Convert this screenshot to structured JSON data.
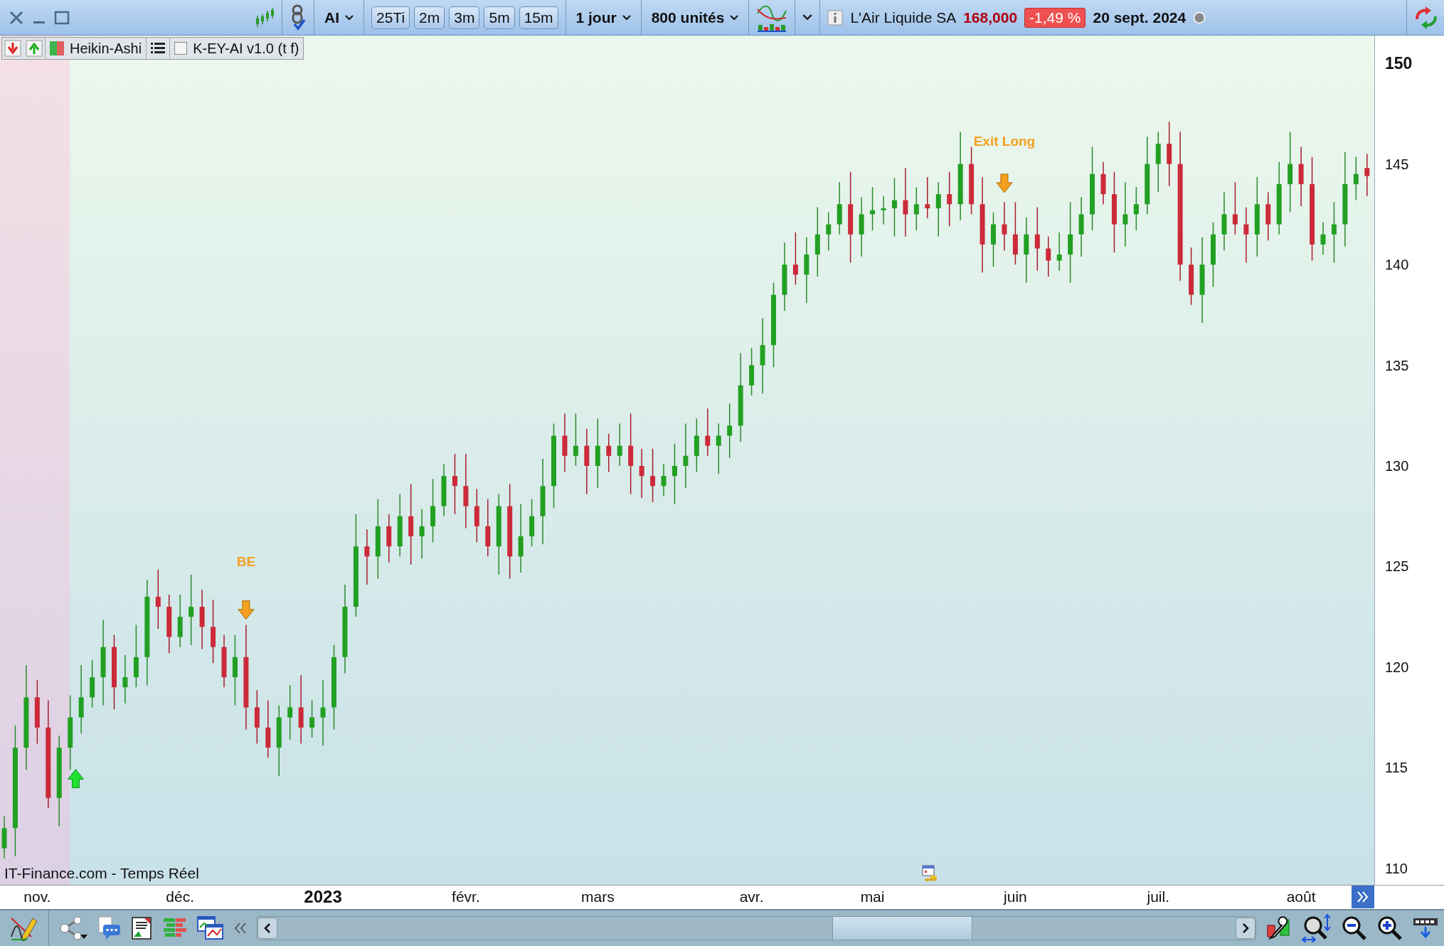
{
  "toolbar": {
    "instrument_code": "AI",
    "intervals": [
      {
        "label": "25Ti",
        "selected": false
      },
      {
        "label": "2m",
        "selected": false
      },
      {
        "label": "3m",
        "selected": false
      },
      {
        "label": "5m",
        "selected": false
      },
      {
        "label": "15m",
        "selected": false
      }
    ],
    "period": "1 jour",
    "units": "800 unités",
    "instrument": {
      "name": "L'Air Liquide SA",
      "price": "168,000",
      "change": "-1,49 %",
      "date": "20 sept. 2024"
    }
  },
  "chart_legend": {
    "style": "Heikin-Ashi",
    "indicator": {
      "label": "K-EY-AI v1.0 (t f)",
      "checked": false
    }
  },
  "chart": {
    "source": "IT-Finance.com - Temps Réel",
    "signals": [
      {
        "kind": "buy"
      },
      {
        "kind": "sell"
      },
      {
        "kind": "sell"
      }
    ],
    "chart_data": {
      "type": "candlestick",
      "ylim": [
        109.15,
        151.38
      ],
      "yticks": [
        110,
        115,
        120,
        125,
        130,
        135,
        140,
        145,
        150
      ],
      "categories": [
        null,
        null,
        null,
        "nov.",
        null,
        null,
        null,
        null,
        null,
        null,
        null,
        null,
        null,
        null,
        null,
        null,
        "déc.",
        null,
        null,
        null,
        null,
        null,
        null,
        null,
        null,
        null,
        null,
        null,
        null,
        "2023",
        null,
        null,
        null,
        null,
        null,
        null,
        null,
        null,
        null,
        null,
        null,
        null,
        "févr.",
        null,
        null,
        null,
        null,
        null,
        null,
        null,
        null,
        null,
        null,
        null,
        "mars",
        null,
        null,
        null,
        null,
        null,
        null,
        null,
        null,
        null,
        null,
        null,
        null,
        null,
        "avr.",
        null,
        null,
        null,
        null,
        null,
        null,
        null,
        null,
        null,
        null,
        "mai",
        null,
        null,
        null,
        null,
        null,
        null,
        null,
        null,
        null,
        null,
        null,
        null,
        "juin",
        null,
        null,
        null,
        null,
        null,
        null,
        null,
        null,
        null,
        null,
        null,
        null,
        "juil.",
        null,
        null,
        null,
        null,
        null,
        null,
        null,
        null,
        null,
        null,
        null,
        null,
        "août",
        null,
        null,
        null,
        null,
        null,
        null
      ],
      "ohlc": [
        [
          111,
          112.6,
          110.5,
          112
        ],
        [
          112,
          117.1,
          110.6,
          116
        ],
        [
          116,
          120.1,
          114.9,
          118.5
        ],
        [
          118.5,
          119.35,
          116.2,
          117
        ],
        [
          117,
          118.35,
          113,
          113.5
        ],
        [
          113.5,
          116.6,
          112.1,
          116
        ],
        [
          116,
          118.6,
          114.9,
          117.5
        ],
        [
          117.5,
          120.1,
          116.7,
          118.5
        ],
        [
          118.5,
          120.35,
          118,
          119.5
        ],
        [
          119.5,
          122.35,
          118.1,
          121
        ],
        [
          121,
          121.6,
          117.9,
          119
        ],
        [
          119,
          120.6,
          118.2,
          119.5
        ],
        [
          119.5,
          122.1,
          119,
          120.5
        ],
        [
          120.5,
          124.35,
          119.1,
          123.5
        ],
        [
          123.5,
          124.85,
          121.9,
          123
        ],
        [
          123,
          123.6,
          120.7,
          121.5
        ],
        [
          121.5,
          123.6,
          121,
          122.5
        ],
        [
          122.5,
          124.6,
          121.1,
          123
        ],
        [
          123,
          123.85,
          120.9,
          122
        ],
        [
          122,
          123.35,
          120.2,
          121
        ],
        [
          121,
          121.6,
          119,
          119.5
        ],
        [
          119.5,
          121.6,
          118.1,
          120.5
        ],
        [
          120.5,
          122.1,
          116.9,
          118
        ],
        [
          118,
          118.85,
          116.2,
          117
        ],
        [
          117,
          118.35,
          115.5,
          116
        ],
        [
          116,
          118.1,
          114.6,
          117.5
        ],
        [
          117.5,
          119.1,
          116.4,
          118
        ],
        [
          118,
          119.6,
          116.2,
          117
        ],
        [
          117,
          118.35,
          116.5,
          117.5
        ],
        [
          117.5,
          119.35,
          116.1,
          118
        ],
        [
          118,
          121.1,
          116.9,
          120.5
        ],
        [
          120.5,
          124.1,
          119.7,
          123
        ],
        [
          123,
          127.6,
          122.5,
          126
        ],
        [
          126,
          126.85,
          124.1,
          125.5
        ],
        [
          125.5,
          128.35,
          124.4,
          127
        ],
        [
          127,
          127.6,
          125.2,
          126
        ],
        [
          126,
          128.6,
          125.5,
          127.5
        ],
        [
          127.5,
          129.1,
          125.1,
          126.5
        ],
        [
          126.5,
          127.85,
          125.4,
          127
        ],
        [
          127,
          129.35,
          126.2,
          128
        ],
        [
          128,
          130.1,
          127.5,
          129.5
        ],
        [
          129.5,
          130.6,
          127.6,
          129
        ],
        [
          129,
          130.6,
          126.9,
          128
        ],
        [
          128,
          128.85,
          126.2,
          127
        ],
        [
          127,
          128.35,
          125.5,
          126
        ],
        [
          126,
          128.6,
          124.6,
          128
        ],
        [
          128,
          129.1,
          124.4,
          125.5
        ],
        [
          125.5,
          128.1,
          124.7,
          126.5
        ],
        [
          126.5,
          128.35,
          126,
          127.5
        ],
        [
          127.5,
          130.35,
          126.1,
          129
        ],
        [
          129,
          132.1,
          127.9,
          131.5
        ],
        [
          131.5,
          132.6,
          129.7,
          130.5
        ],
        [
          130.5,
          132.6,
          130,
          131
        ],
        [
          131,
          131.85,
          128.6,
          130
        ],
        [
          130,
          132.35,
          128.9,
          131
        ],
        [
          131,
          131.6,
          129.7,
          130.5
        ],
        [
          130.5,
          132.1,
          130,
          131
        ],
        [
          131,
          132.6,
          128.6,
          130
        ],
        [
          130,
          130.85,
          128.4,
          129.5
        ],
        [
          129.5,
          130.85,
          128.2,
          129
        ],
        [
          129,
          130.1,
          128.5,
          129.5
        ],
        [
          129.5,
          131.1,
          128.1,
          130
        ],
        [
          130,
          132.1,
          128.9,
          130.5
        ],
        [
          130.5,
          132.35,
          129.7,
          131.5
        ],
        [
          131.5,
          132.85,
          130.5,
          131
        ],
        [
          131,
          132.1,
          129.6,
          131.5
        ],
        [
          131.5,
          133.1,
          130.4,
          132
        ],
        [
          132,
          135.6,
          131.2,
          134
        ],
        [
          134,
          135.85,
          133.5,
          135
        ],
        [
          135,
          137.35,
          133.6,
          136
        ],
        [
          136,
          139.1,
          134.9,
          138.5
        ],
        [
          138.5,
          141.1,
          137.7,
          140
        ],
        [
          140,
          141.6,
          139,
          139.5
        ],
        [
          139.5,
          141.35,
          138.1,
          140.5
        ],
        [
          140.5,
          142.85,
          139.4,
          141.5
        ],
        [
          141.5,
          142.6,
          140.7,
          142
        ],
        [
          142,
          144.1,
          141.5,
          143
        ],
        [
          143,
          144.6,
          140.1,
          141.5
        ],
        [
          141.5,
          143.35,
          140.4,
          142.5
        ],
        [
          142.5,
          143.85,
          141.7,
          142.7
        ],
        [
          142.7,
          143.4,
          142,
          142.8
        ],
        [
          142.8,
          144.3,
          141.4,
          143.2
        ],
        [
          143.2,
          144.8,
          141.4,
          142.5
        ],
        [
          142.5,
          143.85,
          141.7,
          143
        ],
        [
          143,
          144.35,
          142.3,
          142.8
        ],
        [
          142.8,
          144.1,
          141.4,
          143.5
        ],
        [
          143.5,
          144.6,
          141.9,
          143
        ],
        [
          143,
          146.6,
          142.2,
          145
        ],
        [
          145,
          145.85,
          142.5,
          143
        ],
        [
          143,
          144.35,
          139.6,
          141
        ],
        [
          141,
          142.6,
          139.9,
          142
        ],
        [
          142,
          143.1,
          140.7,
          141.5
        ],
        [
          141.5,
          143.1,
          140,
          140.5
        ],
        [
          140.5,
          142.35,
          139.1,
          141.5
        ],
        [
          141.5,
          142.85,
          139.7,
          140.8
        ],
        [
          140.8,
          141.4,
          139.4,
          140.2
        ],
        [
          140.2,
          141.6,
          139.7,
          140.5
        ],
        [
          140.5,
          143.1,
          139.1,
          141.5
        ],
        [
          141.5,
          143.35,
          140.4,
          142.5
        ],
        [
          142.5,
          145.85,
          141.7,
          144.5
        ],
        [
          144.5,
          145.1,
          143,
          143.5
        ],
        [
          143.5,
          144.6,
          140.6,
          142
        ],
        [
          142,
          144.1,
          140.9,
          142.5
        ],
        [
          142.5,
          143.85,
          141.7,
          143
        ],
        [
          143,
          146.35,
          142.5,
          145
        ],
        [
          145,
          146.6,
          143.6,
          146
        ],
        [
          146,
          147.1,
          143.9,
          145
        ],
        [
          145,
          146.6,
          139.2,
          140
        ],
        [
          140,
          140.85,
          138,
          138.5
        ],
        [
          138.5,
          141.35,
          137.1,
          140
        ],
        [
          140,
          142.1,
          138.9,
          141.5
        ],
        [
          141.5,
          143.6,
          140.7,
          142.5
        ],
        [
          142.5,
          144.1,
          141.5,
          142
        ],
        [
          142,
          142.85,
          140.1,
          141.5
        ],
        [
          141.5,
          144.35,
          140.4,
          143
        ],
        [
          143,
          143.6,
          141.2,
          142
        ],
        [
          142,
          145.1,
          141.5,
          144
        ],
        [
          144,
          146.6,
          142.6,
          145
        ],
        [
          145,
          145.85,
          142.9,
          144
        ],
        [
          144,
          145.35,
          140.2,
          141
        ],
        [
          141,
          142.1,
          140.5,
          141.5
        ],
        [
          141.5,
          143.1,
          140.1,
          142
        ],
        [
          142,
          145.6,
          140.9,
          144
        ],
        [
          144,
          145.35,
          143.2,
          144.5
        ],
        [
          144.8,
          145.5,
          143.4,
          144.4
        ]
      ],
      "annotations": [
        "BE",
        "Exit Long"
      ]
    }
  }
}
